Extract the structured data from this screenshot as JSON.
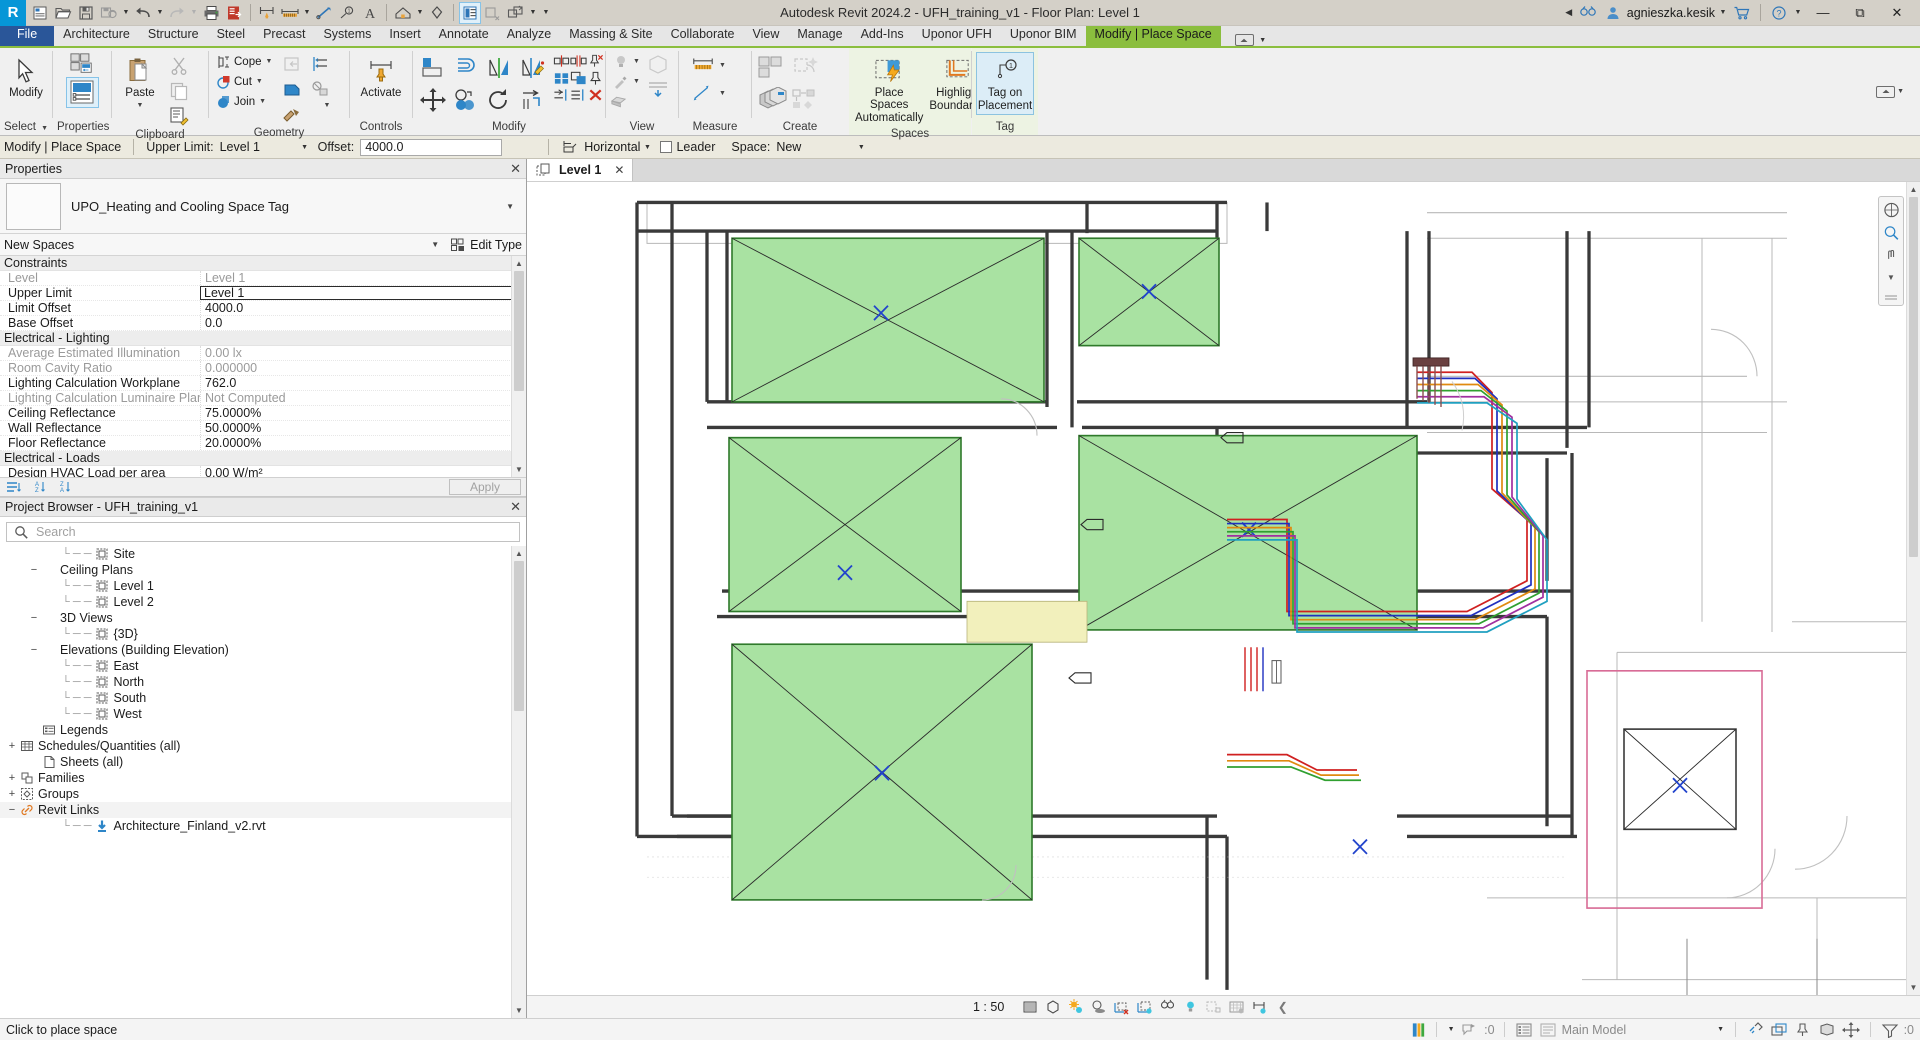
{
  "titlebar": {
    "app_title": "Autodesk Revit 2024.2 - UFH_training_v1 - Floor Plan: Level 1",
    "logo_letter": "R",
    "user_name": "agnieszka.kesik",
    "qat_icons": [
      "new-project-icon",
      "open-icon",
      "save-icon",
      "save-as-cloud-icon",
      "undo-icon",
      "redo-icon",
      "print-icon",
      "sync-with-central-icon",
      "measure-icon",
      "aligned-dimension-icon",
      "tag-by-category-icon",
      "text-note-icon",
      "default-3d-view-icon",
      "section-icon",
      "close-hidden-windows-icon",
      "switch-windows-icon",
      "customize-qat-icon"
    ],
    "right_icons": [
      "collapse-ribbon-icon",
      "search-icon",
      "account-icon",
      "autodesk-store-icon",
      "help-icon"
    ],
    "window_buttons": [
      "minimize",
      "restore",
      "close"
    ]
  },
  "ribbon": {
    "tabs": [
      {
        "label": "File",
        "kind": "file"
      },
      {
        "label": "Architecture",
        "kind": "normal"
      },
      {
        "label": "Structure",
        "kind": "normal"
      },
      {
        "label": "Steel",
        "kind": "normal"
      },
      {
        "label": "Precast",
        "kind": "normal"
      },
      {
        "label": "Systems",
        "kind": "normal"
      },
      {
        "label": "Insert",
        "kind": "normal"
      },
      {
        "label": "Annotate",
        "kind": "normal"
      },
      {
        "label": "Analyze",
        "kind": "normal"
      },
      {
        "label": "Massing & Site",
        "kind": "normal"
      },
      {
        "label": "Collaborate",
        "kind": "normal"
      },
      {
        "label": "View",
        "kind": "normal"
      },
      {
        "label": "Manage",
        "kind": "normal"
      },
      {
        "label": "Add-Ins",
        "kind": "normal"
      },
      {
        "label": "Uponor UFH",
        "kind": "normal"
      },
      {
        "label": "Uponor BIM",
        "kind": "normal"
      },
      {
        "label": "Modify | Place Space",
        "kind": "contextual"
      }
    ],
    "active_tab": "Modify | Place Space",
    "panels": {
      "select": {
        "label": "Select",
        "modify_button": "Modify"
      },
      "properties": {
        "label": "Properties"
      },
      "clipboard": {
        "label": "Clipboard",
        "paste": "Paste"
      },
      "geometry": {
        "label": "Geometry",
        "cope": "Cope",
        "cut": "Cut",
        "join": "Join"
      },
      "controls": {
        "label": "Controls",
        "activate": "Activate"
      },
      "modify": {
        "label": "Modify"
      },
      "view": {
        "label": "View"
      },
      "measure": {
        "label": "Measure"
      },
      "create": {
        "label": "Create"
      },
      "spaces": {
        "label": "Spaces",
        "place_spaces_automatically": "Place Spaces\nAutomatically",
        "place_spaces_l1": "Place Spaces",
        "place_spaces_l2": "Automatically",
        "highlight_l1": "Highlight",
        "highlight_l2": "Boundaries"
      },
      "tag": {
        "label": "Tag",
        "tag_on_placement_l1": "Tag on",
        "tag_on_placement_l2": "Placement"
      }
    }
  },
  "options_bar": {
    "context_label": "Modify | Place Space",
    "upper_limit_label": "Upper Limit:",
    "upper_limit_value": "Level 1",
    "offset_label": "Offset:",
    "offset_value": "4000.0",
    "orientation_value": "Horizontal",
    "leader_label": "Leader",
    "leader_checked": false,
    "space_label": "Space:",
    "space_value": "New"
  },
  "properties_palette": {
    "title": "Properties",
    "type_name": "UPO_Heating and Cooling Space Tag",
    "selector_value": "New Spaces",
    "edit_type_label": "Edit Type",
    "apply_label": "Apply",
    "groups": [
      {
        "name": "Constraints",
        "rows": [
          {
            "name": "Level",
            "value": "Level 1",
            "disabled": true,
            "boxed": false
          },
          {
            "name": "Upper Limit",
            "value": "Level 1",
            "disabled": false,
            "boxed": true
          },
          {
            "name": "Limit Offset",
            "value": "4000.0",
            "disabled": false,
            "boxed": false
          },
          {
            "name": "Base Offset",
            "value": "0.0",
            "disabled": false,
            "boxed": false
          }
        ]
      },
      {
        "name": "Electrical - Lighting",
        "rows": [
          {
            "name": "Average Estimated Illumination",
            "value": "0.00 lx",
            "disabled": true,
            "boxed": false
          },
          {
            "name": "Room Cavity Ratio",
            "value": "0.000000",
            "disabled": true,
            "boxed": false
          },
          {
            "name": "Lighting Calculation Workplane",
            "value": "762.0",
            "disabled": false,
            "boxed": false
          },
          {
            "name": "Lighting Calculation Luminaire Plane",
            "value": "Not Computed",
            "disabled": true,
            "boxed": false
          },
          {
            "name": "Ceiling Reflectance",
            "value": "75.0000%",
            "disabled": false,
            "boxed": false
          },
          {
            "name": "Wall Reflectance",
            "value": "50.0000%",
            "disabled": false,
            "boxed": false
          },
          {
            "name": "Floor Reflectance",
            "value": "20.0000%",
            "disabled": false,
            "boxed": false
          }
        ]
      },
      {
        "name": "Electrical - Loads",
        "rows": [
          {
            "name": "Design HVAC Load per area",
            "value": "0.00 W/m²",
            "disabled": false,
            "boxed": false
          }
        ]
      }
    ]
  },
  "project_browser": {
    "title": "Project Browser - UFH_training_v1",
    "search_placeholder": "Search",
    "tree": [
      {
        "label": "Site",
        "indent": 2,
        "expander": "",
        "icon": "view-icon",
        "selected": false
      },
      {
        "label": "Ceiling Plans",
        "indent": 1,
        "expander": "−",
        "icon": "none",
        "selected": false
      },
      {
        "label": "Level 1",
        "indent": 2,
        "expander": "",
        "icon": "view-icon",
        "selected": false
      },
      {
        "label": "Level 2",
        "indent": 2,
        "expander": "",
        "icon": "view-icon",
        "selected": false
      },
      {
        "label": "3D Views",
        "indent": 1,
        "expander": "−",
        "icon": "none",
        "selected": false
      },
      {
        "label": "{3D}",
        "indent": 2,
        "expander": "",
        "icon": "view-icon",
        "selected": false
      },
      {
        "label": "Elevations (Building Elevation)",
        "indent": 1,
        "expander": "−",
        "icon": "none",
        "selected": false
      },
      {
        "label": "East",
        "indent": 2,
        "expander": "",
        "icon": "view-icon",
        "selected": false
      },
      {
        "label": "North",
        "indent": 2,
        "expander": "",
        "icon": "view-icon",
        "selected": false
      },
      {
        "label": "South",
        "indent": 2,
        "expander": "",
        "icon": "view-icon",
        "selected": false
      },
      {
        "label": "West",
        "indent": 2,
        "expander": "",
        "icon": "view-icon",
        "selected": false
      },
      {
        "label": "Legends",
        "indent": 1,
        "expander": "",
        "icon": "legend-icon",
        "selected": false
      },
      {
        "label": "Schedules/Quantities (all)",
        "indent": 0,
        "expander": "+",
        "icon": "schedule-icon",
        "selected": false
      },
      {
        "label": "Sheets (all)",
        "indent": 1,
        "expander": "",
        "icon": "sheet-icon",
        "selected": false
      },
      {
        "label": "Families",
        "indent": 0,
        "expander": "+",
        "icon": "family-icon",
        "selected": false
      },
      {
        "label": "Groups",
        "indent": 0,
        "expander": "+",
        "icon": "group-icon",
        "selected": false
      },
      {
        "label": "Revit Links",
        "indent": 0,
        "expander": "−",
        "icon": "link-icon",
        "selected": true
      },
      {
        "label": "Architecture_Finland_v2.rvt",
        "indent": 2,
        "expander": "",
        "icon": "rvt-link-icon",
        "selected": false
      }
    ]
  },
  "view_tabs": [
    {
      "label": "Level 1",
      "active": true
    }
  ],
  "view_control_bar": {
    "scale": "1 : 50",
    "icons": [
      "detail-level-icon",
      "visual-style-icon",
      "sun-path-icon",
      "shadows-icon",
      "render-dialog-icon",
      "crop-view-icon",
      "show-crop-region-icon",
      "analytical-model-icon",
      "temporary-hide-isolate-icon",
      "reveal-hidden-elements-icon",
      "temporary-view-properties-icon",
      "hide-constraints-icon",
      "expand-icon"
    ]
  },
  "status_bar": {
    "message": "Click to place space",
    "warning_count": ":0",
    "worksets_label": "Main Model",
    "exclude_count": ":0",
    "right_icons": [
      "select-links-icon",
      "select-underlay-icon",
      "select-pinned-icon",
      "select-by-face-icon",
      "drag-elements-icon",
      "filter-icon"
    ]
  },
  "canvas": {
    "space_fill_color": "#a9e2a2",
    "space_outline_color": "#2f7a2b",
    "wall_color": "#404040",
    "pipe_colors": [
      "#d02020",
      "#2030c0",
      "#e08a10",
      "#30a030",
      "#a030a0",
      "#20a0c0"
    ],
    "crop_region_color": "#d86c96"
  }
}
